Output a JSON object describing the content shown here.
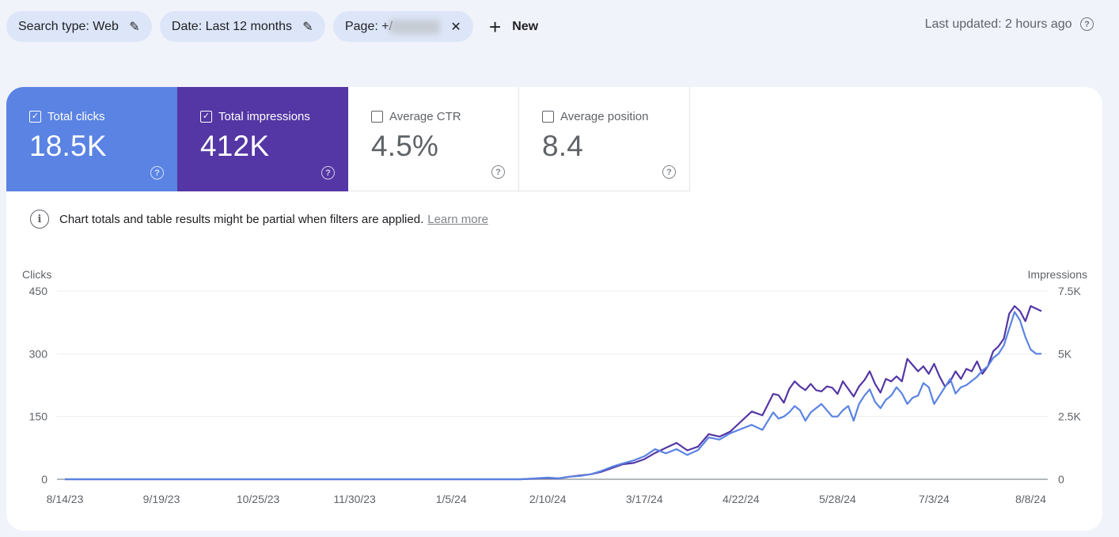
{
  "filters": [
    {
      "label": "Search type: Web",
      "icon": "pencil-icon",
      "icon_glyph": "✎"
    },
    {
      "label": "Date: Last 12 months",
      "icon": "pencil-icon",
      "icon_glyph": "✎"
    },
    {
      "label": "Page: +/",
      "icon": "close-icon",
      "icon_glyph": "✕",
      "value_redacted": true
    }
  ],
  "new_button": {
    "label": "New",
    "icon_glyph": "+"
  },
  "last_updated": "Last updated: 2 hours ago",
  "help_glyph": "?",
  "metrics": [
    {
      "label": "Total clicks",
      "value": "18.5K",
      "checked": true,
      "color": "#5a83e3"
    },
    {
      "label": "Total impressions",
      "value": "412K",
      "checked": true,
      "color": "#5436a4"
    },
    {
      "label": "Average CTR",
      "value": "4.5%",
      "checked": false
    },
    {
      "label": "Average position",
      "value": "8.4",
      "checked": false
    }
  ],
  "checkbox_glyph": "✓",
  "notice": {
    "text": "Chart totals and table results might be partial when filters are applied.",
    "link": "Learn more",
    "icon_glyph": "i"
  },
  "chart_data": {
    "type": "line",
    "title": "",
    "ylabel": "Clicks",
    "y2label": "Impressions",
    "ylim": [
      0,
      450
    ],
    "y2lim": [
      0,
      7500
    ],
    "yticks": [
      "0",
      "150",
      "300",
      "450"
    ],
    "y2ticks": [
      "0",
      "2.5K",
      "5K",
      "7.5K"
    ],
    "xticks": [
      "8/14/23",
      "9/19/23",
      "10/25/23",
      "11/30/23",
      "1/5/24",
      "2/10/24",
      "3/17/24",
      "4/22/24",
      "5/28/24",
      "7/3/24",
      "8/8/24"
    ],
    "x_days_range": [
      0,
      364
    ],
    "grid": true,
    "series": [
      {
        "name": "Impressions",
        "axis": "right",
        "color": "#5436a4",
        "x_days": [
          0,
          170,
          180,
          184,
          188,
          192,
          196,
          200,
          204,
          208,
          212,
          216,
          220,
          224,
          228,
          232,
          236,
          240,
          244,
          248,
          252,
          256,
          260,
          264,
          266,
          268,
          270,
          272,
          274,
          276,
          278,
          280,
          282,
          284,
          286,
          288,
          290,
          292,
          294,
          296,
          298,
          300,
          302,
          304,
          306,
          308,
          310,
          312,
          314,
          316,
          318,
          320,
          322,
          324,
          326,
          328,
          330,
          332,
          334,
          336,
          338,
          340,
          342,
          344,
          346,
          348,
          350,
          352,
          354,
          356,
          358,
          360,
          362,
          364
        ],
        "values": [
          0,
          0,
          50,
          30,
          100,
          150,
          200,
          300,
          450,
          600,
          650,
          800,
          1050,
          1250,
          1450,
          1150,
          1300,
          1800,
          1700,
          1900,
          2300,
          2700,
          2550,
          3400,
          3350,
          3050,
          3600,
          3900,
          3700,
          3550,
          3800,
          3550,
          3500,
          3700,
          3650,
          3400,
          3900,
          3600,
          3300,
          3700,
          3950,
          4300,
          3800,
          3450,
          4000,
          3900,
          4100,
          3900,
          4800,
          4550,
          4300,
          4500,
          4200,
          4600,
          4100,
          3700,
          3900,
          4300,
          4000,
          4400,
          4300,
          4700,
          4200,
          4500,
          5100,
          5300,
          5600,
          6600,
          6900,
          6700,
          6300,
          6900,
          6800,
          6700
        ]
      },
      {
        "name": "Clicks",
        "axis": "left",
        "color": "#5a83e3",
        "x_days": [
          0,
          170,
          180,
          184,
          188,
          192,
          196,
          200,
          204,
          208,
          212,
          216,
          220,
          224,
          228,
          232,
          236,
          240,
          244,
          248,
          252,
          256,
          260,
          264,
          266,
          268,
          270,
          272,
          274,
          276,
          278,
          280,
          282,
          284,
          286,
          288,
          290,
          292,
          294,
          296,
          298,
          300,
          302,
          304,
          306,
          308,
          310,
          312,
          314,
          316,
          318,
          320,
          322,
          324,
          326,
          328,
          330,
          332,
          334,
          336,
          338,
          340,
          342,
          344,
          346,
          348,
          350,
          352,
          354,
          356,
          358,
          360,
          362,
          364
        ],
        "values": [
          0,
          0,
          4,
          2,
          6,
          8,
          12,
          20,
          30,
          38,
          45,
          55,
          72,
          62,
          72,
          58,
          70,
          100,
          95,
          110,
          120,
          130,
          118,
          160,
          145,
          150,
          160,
          175,
          165,
          140,
          160,
          170,
          180,
          165,
          150,
          150,
          165,
          175,
          140,
          180,
          200,
          215,
          185,
          170,
          190,
          200,
          220,
          205,
          180,
          195,
          200,
          230,
          220,
          180,
          200,
          220,
          240,
          205,
          220,
          225,
          235,
          245,
          260,
          270,
          290,
          300,
          320,
          360,
          400,
          380,
          340,
          310,
          300,
          300
        ]
      }
    ]
  }
}
